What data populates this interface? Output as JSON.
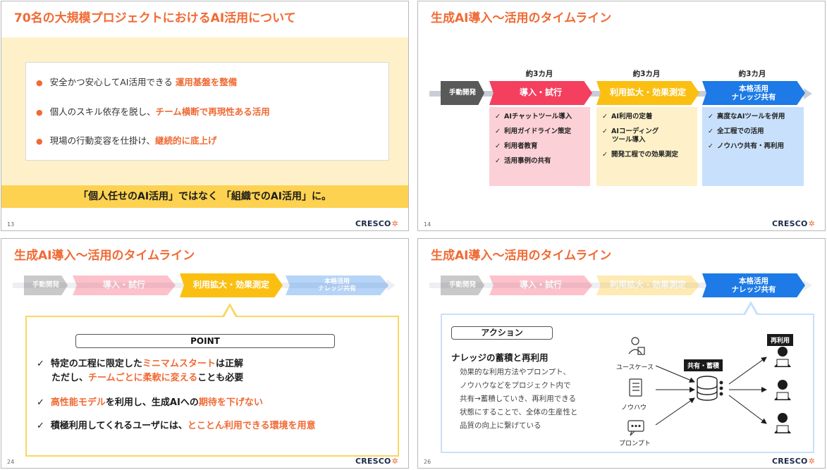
{
  "slide13": {
    "title": "70名の大規模プロジェクトにおけるAI活用について",
    "items": [
      {
        "bullet": "●",
        "text": "安全かつ安心してAI活用できる ",
        "emphasis": "運用基盤を整備"
      },
      {
        "bullet": "●",
        "text": "個人のスキル依存を脱し、",
        "emphasis": "チーム横断で再現性ある活用"
      },
      {
        "bullet": "●",
        "text": "現場の行動変容を仕掛け、",
        "emphasis": "継続的に底上げ"
      }
    ],
    "banner": "「個人任せのAI活用」ではなく 「組織でのAI活用」に。",
    "page": "13",
    "logo": "CRESCO",
    "logo_mark": "✲"
  },
  "slide14": {
    "title": "生成AI導入～活用のタイムライン",
    "page": "14",
    "logo": "CRESCO",
    "logo_mark": "✲",
    "stages": {
      "dev": "手動開発",
      "p1": "導入・試行",
      "p2": "利用拡大・効果測定",
      "p3_line1": "本格活用",
      "p3_line2": "ナレッジ共有"
    },
    "durations": [
      "約3カ月",
      "約3カ月",
      "約3カ月"
    ],
    "check": "✓",
    "phase1_items": [
      "AIチャットツール導入",
      "利用ガイドライン策定",
      "利用者教育",
      "活用事例の共有"
    ],
    "phase2_items": [
      "AI利用の定着",
      "AIコーディング",
      "ツール導入",
      "開発工程での効果測定"
    ],
    "phase3_items": [
      "高度なAIツールを併用",
      "全工程での活用",
      "ノウハウ共有・再利用"
    ]
  },
  "slide24": {
    "title": "生成AI導入～活用のタイムライン",
    "page": "24",
    "logo": "CRESCO",
    "logo_mark": "✲",
    "stages": {
      "dev": "手動開発",
      "p1": "導入・試行",
      "p2": "利用拡大・効果測定",
      "p3_line1": "本格活用",
      "p3_line2": "ナレッジ共有"
    },
    "point_label": "POINT",
    "check": "✓",
    "p1_a": "特定の工程に限定した",
    "p1_em": "ミニマムスタート",
    "p1_b": "は正解",
    "p1_c": "ただし、",
    "p1_em2": "チームごとに柔軟に変える",
    "p1_d": "ことも必要",
    "p2_em": "高性能モデル",
    "p2_a": "を利用し、生成AIへの",
    "p2_em2": "期待を下げない",
    "p3_a": "積極利用してくれるユーザには、",
    "p3_em": "とことん利用できる環境を用意"
  },
  "slide26": {
    "title": "生成AI導入～活用のタイムライン",
    "page": "26",
    "logo": "CRESCO",
    "logo_mark": "✲",
    "stages": {
      "dev": "手動開発",
      "p1": "導入・試行",
      "p2": "利用拡大・効果測定",
      "p3_line1": "本格活用",
      "p3_line2": "ナレッジ共有"
    },
    "action_label": "アクション",
    "heading": "ナレッジの蓄積と再利用",
    "body": [
      "効果的な利用方法やプロンプト、",
      "ノウハウなどをプロジェクト内で",
      "共有→蓄積していき、再利用できる",
      "状態にすることで、全体の生産性と",
      "品質の向上に繋げている"
    ],
    "inputs": [
      "ユースケース",
      "ノウハウ",
      "プロンプト"
    ],
    "hub_label": "共有・蓄積",
    "reuse_label": "再利用"
  }
}
